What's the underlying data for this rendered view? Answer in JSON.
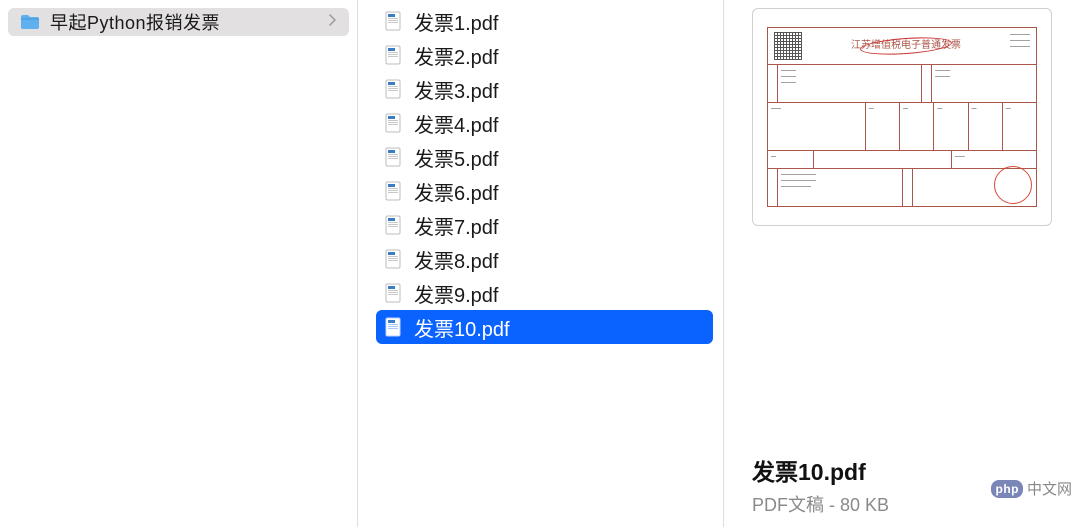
{
  "sidebar": {
    "items": [
      {
        "label": "早起Python报销发票"
      }
    ]
  },
  "files": [
    {
      "name": "发票1.pdf",
      "selected": false
    },
    {
      "name": "发票2.pdf",
      "selected": false
    },
    {
      "name": "发票3.pdf",
      "selected": false
    },
    {
      "name": "发票4.pdf",
      "selected": false
    },
    {
      "name": "发票5.pdf",
      "selected": false
    },
    {
      "name": "发票6.pdf",
      "selected": false
    },
    {
      "name": "发票7.pdf",
      "selected": false
    },
    {
      "name": "发票8.pdf",
      "selected": false
    },
    {
      "name": "发票9.pdf",
      "selected": false
    },
    {
      "name": "发票10.pdf",
      "selected": true
    }
  ],
  "preview": {
    "title": "发票10.pdf",
    "kind": "PDF文稿",
    "sep": " - ",
    "size": "80 KB",
    "invoice_title": "江苏增值税电子普通发票"
  },
  "watermark": {
    "badge": "php",
    "text": "中文网"
  }
}
